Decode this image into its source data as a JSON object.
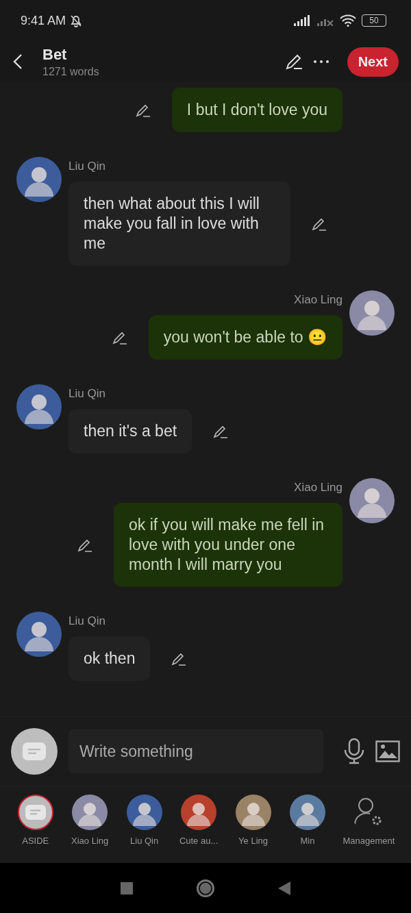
{
  "status_bar": {
    "time": "9:41 AM",
    "battery": "50"
  },
  "header": {
    "title": "Bet",
    "subtitle": "1271 words",
    "next_button": "Next"
  },
  "messages": [
    {
      "kind": "outgoing",
      "text": "I but I don't love you"
    },
    {
      "kind": "incoming",
      "name": "Liu Qin",
      "text": "then what about this I will make you fall in love with me",
      "color": "#3c5c9c"
    },
    {
      "kind": "outgoing",
      "name": "Xiao Ling",
      "text": "you won't be able to 😐",
      "color": "#8a8aa6"
    },
    {
      "kind": "incoming",
      "name": "Liu Qin",
      "text": "then it's a bet",
      "color": "#3c5c9c"
    },
    {
      "kind": "outgoing",
      "name": "Xiao Ling",
      "text": "ok if you will make me fell in love with you under one month I will marry you",
      "color": "#8a8aa6"
    },
    {
      "kind": "incoming",
      "name": "Liu Qin",
      "text": "ok then",
      "color": "#3c5c9c"
    }
  ],
  "composer": {
    "placeholder": "Write something"
  },
  "characters": [
    {
      "kind": "aside",
      "label": "ASIDE",
      "selected": true,
      "color": "#bbbbbb"
    },
    {
      "kind": "character",
      "label": "Xiao Ling",
      "selected": false,
      "color": "#8a8aa6"
    },
    {
      "kind": "character",
      "label": "Liu Qin",
      "selected": false,
      "color": "#3c5c9c"
    },
    {
      "kind": "character",
      "label": "Cute au...",
      "selected": false,
      "color": "#b8402c"
    },
    {
      "kind": "character",
      "label": "Ye Ling",
      "selected": false,
      "color": "#9a8266"
    },
    {
      "kind": "character",
      "label": "Min",
      "selected": false,
      "color": "#5a7aa0"
    },
    {
      "kind": "management",
      "label": "Management",
      "selected": false,
      "color": "#9a9a9a"
    }
  ]
}
